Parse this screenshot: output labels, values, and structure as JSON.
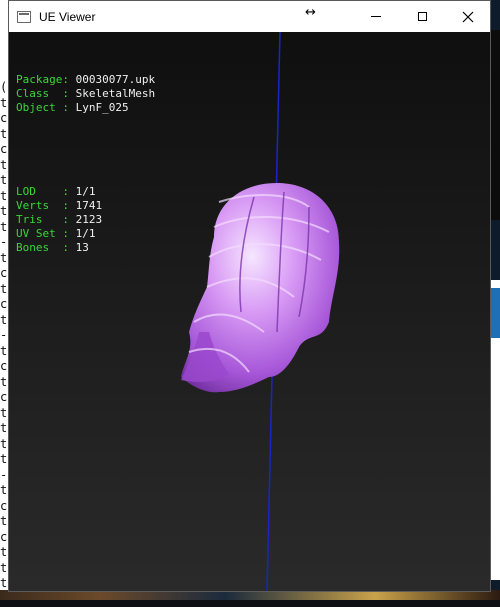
{
  "window": {
    "title": "UE Viewer",
    "icon": "app-window-icon",
    "controls": {
      "minimize": "minimize-icon",
      "maximize": "maximize-icon",
      "close": "close-icon"
    }
  },
  "info": {
    "asset": [
      {
        "label": "Package",
        "sep": ": ",
        "value": "00030077.upk"
      },
      {
        "label": "Class  ",
        "sep": ": ",
        "value": "SkeletalMesh"
      },
      {
        "label": "Object ",
        "sep": ": ",
        "value": "LynF_025"
      }
    ],
    "stats": [
      {
        "label": "LOD    ",
        "sep": ": ",
        "value": "1/1"
      },
      {
        "label": "Verts  ",
        "sep": ": ",
        "value": "1741"
      },
      {
        "label": "Tris   ",
        "sep": ": ",
        "value": "2123"
      },
      {
        "label": "UV Set ",
        "sep": ": ",
        "value": "1/1"
      },
      {
        "label": "Bones  ",
        "sep": ": ",
        "value": "13"
      }
    ]
  },
  "colors": {
    "label": "#3ad63a",
    "value": "#f0f0f0",
    "mesh": "#c77af0",
    "axis": "#1a24c8"
  },
  "background": {
    "left_chars": "(\nt\nc\nt\nc\nt\nt\nt\nt\nt\n-\nt\nc\nt\nc\nt\n-\nt\nc\nt\nc\nt\nt\nt\nt\n-\nt\nc\nt\nc\nt\nt\nt\nt"
  }
}
